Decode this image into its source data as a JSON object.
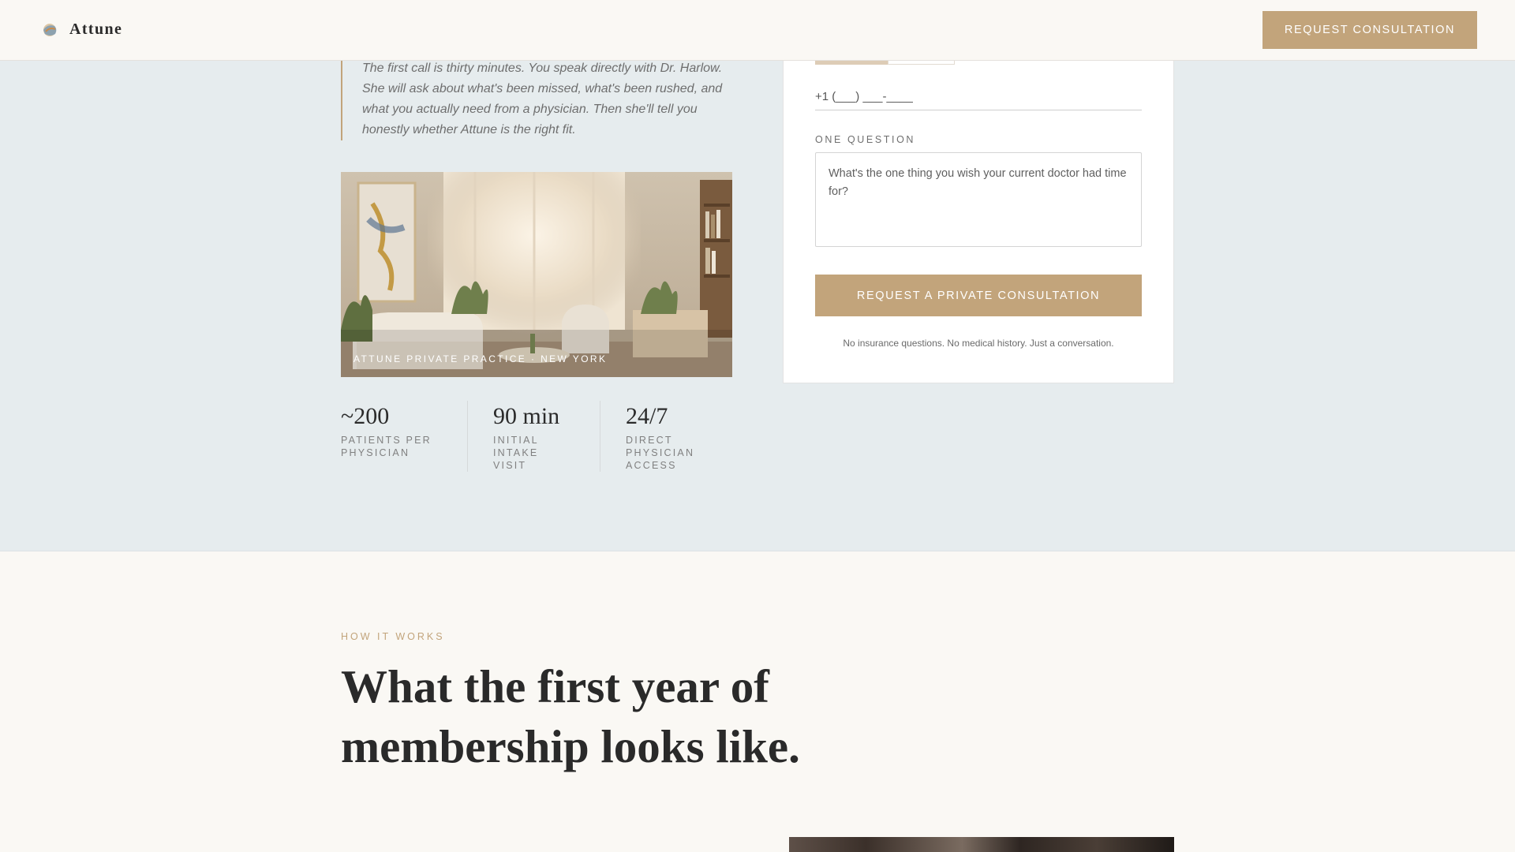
{
  "header": {
    "brand": "Attune",
    "cta_label": "REQUEST CONSULTATION",
    "logo_icon": "attune-logo-icon"
  },
  "intro": {
    "quote": "The first call is thirty minutes. You speak directly with Dr. Harlow. She will ask about what's been missed, what's been rushed, and what you actually need from a physician. Then she'll tell you honestly whether Attune is the right fit.",
    "photo_caption": "ATTUNE PRIVATE PRACTICE · NEW YORK"
  },
  "stats": [
    {
      "value": "~200",
      "label": "PATIENTS PER PHYSICIAN"
    },
    {
      "value": "90 min",
      "label": "INITIAL INTAKE VISIT"
    },
    {
      "value": "24/7",
      "label": "DIRECT PHYSICIAN ACCESS"
    }
  ],
  "form": {
    "phone_placeholder": "+1 (___) ___-____",
    "question_label": "ONE QUESTION",
    "question_placeholder": "What's the one thing you wish your current doctor had time for?",
    "submit_label": "REQUEST A PRIVATE CONSULTATION",
    "note": "No insurance questions. No medical history. Just a conversation."
  },
  "how_it_works": {
    "eyebrow": "HOW IT WORKS",
    "title": "What the first year of membership looks like."
  },
  "colors": {
    "accent": "#c2a47b",
    "hero_bg": "#e6ecee",
    "page_bg": "#faf8f4"
  }
}
